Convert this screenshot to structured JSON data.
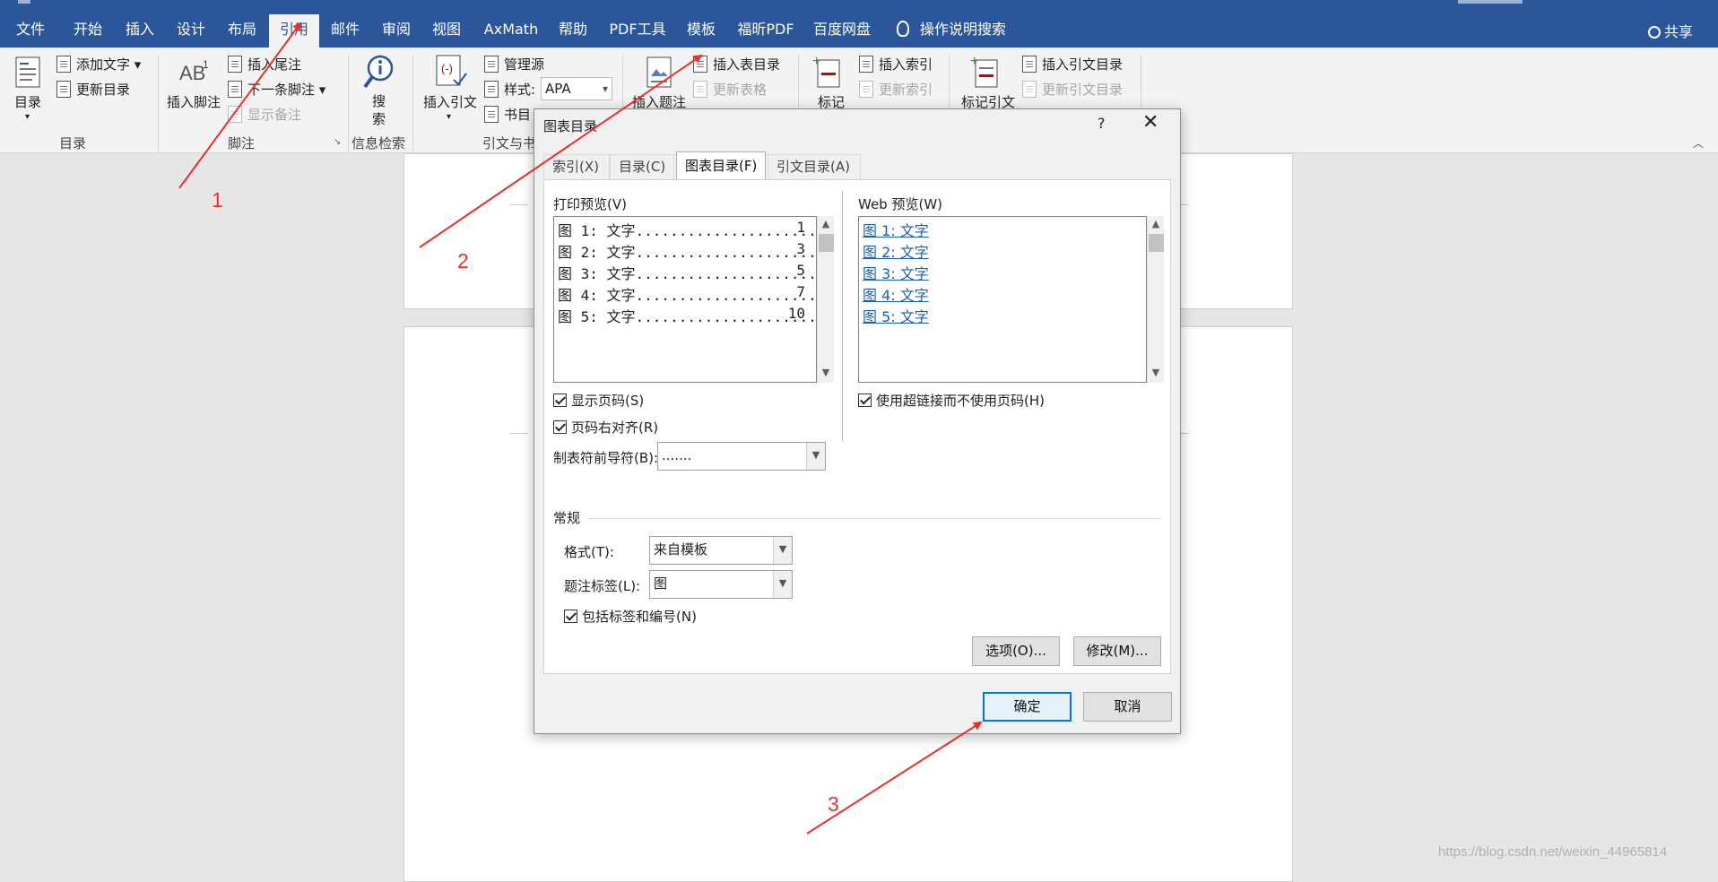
{
  "tabs": [
    {
      "label": "文件"
    },
    {
      "label": "开始"
    },
    {
      "label": "插入"
    },
    {
      "label": "设计"
    },
    {
      "label": "布局"
    },
    {
      "label": "引用"
    },
    {
      "label": "邮件"
    },
    {
      "label": "审阅"
    },
    {
      "label": "视图"
    },
    {
      "label": "AxMath"
    },
    {
      "label": "帮助"
    },
    {
      "label": "PDF工具"
    },
    {
      "label": "模板"
    },
    {
      "label": "福昕PDF"
    },
    {
      "label": "百度网盘"
    }
  ],
  "search_tab": "操作说明搜索",
  "share": "共享",
  "ribbon": {
    "toc": {
      "big": "目录",
      "add_text": "添加文字",
      "update": "更新目录",
      "group": "目录"
    },
    "footnote": {
      "insert": "插入脚注",
      "insert_endnote": "插入尾注",
      "next_footnote": "下一条脚注",
      "show_notes": "显示备注",
      "group": "脚注"
    },
    "research": {
      "big": "搜\n索",
      "group": "信息检索"
    },
    "citations": {
      "insert": "插入引文",
      "manage": "管理源",
      "style_label": "样式:",
      "style_value": "APA",
      "bibliography": "书目",
      "group": "引文与书目"
    },
    "captions": {
      "insert": "插入题注",
      "insert_tof": "插入表目录",
      "update_table": "更新表格"
    },
    "index": {
      "mark": "标记",
      "insert": "插入索引",
      "update": "更新索引"
    },
    "toa": {
      "mark": "标记引文",
      "insert": "插入引文目录",
      "update": "更新引文目录"
    }
  },
  "dialog": {
    "title": "图表目录",
    "help": "?",
    "close": "✕",
    "tabs": [
      {
        "label": "索引(X)"
      },
      {
        "label": "目录(C)"
      },
      {
        "label": "图表目录(F)"
      },
      {
        "label": "引文目录(A)"
      }
    ],
    "print_preview_label": "打印预览(V)",
    "print_rows": [
      {
        "text": "图 1: 文字...............................",
        "page": "1"
      },
      {
        "text": "图 2: 文字...............................",
        "page": "3"
      },
      {
        "text": "图 3: 文字...............................",
        "page": "5"
      },
      {
        "text": "图 4: 文字...............................",
        "page": "7"
      },
      {
        "text": "图 5: 文字...............................",
        "page": "10"
      }
    ],
    "web_preview_label": "Web 预览(W)",
    "web_rows": [
      {
        "text": "图 1: 文字"
      },
      {
        "text": "图 2: 文字"
      },
      {
        "text": "图 3: 文字"
      },
      {
        "text": "图 4: 文字"
      },
      {
        "text": "图 5: 文字"
      }
    ],
    "show_page_numbers": "显示页码(S)",
    "right_align": "页码右对齐(R)",
    "use_hyperlinks": "使用超链接而不使用页码(H)",
    "tab_leader_label": "制表符前导符(B):",
    "tab_leader_value": ".......",
    "general_label": "常规",
    "format_label": "格式(T):",
    "format_value": "来自模板",
    "caption_label": "题注标签(L):",
    "caption_value": "图",
    "include_label": "包括标签和编号(N)",
    "options_button": "选项(O)...",
    "modify_button": "修改(M)...",
    "ok_button": "确定",
    "cancel_button": "取消"
  },
  "annotations": {
    "n1": "1",
    "n2": "2",
    "n3": "3",
    "color": "#e8312b"
  },
  "watermark": "https://blog.csdn.net/weixin_44965814"
}
